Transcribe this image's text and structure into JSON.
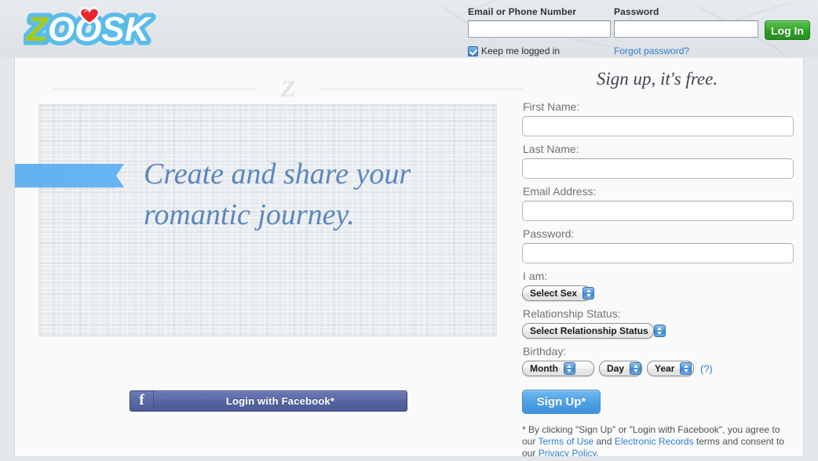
{
  "brand": {
    "name": "ZOOSK",
    "letters": [
      "Z",
      "O",
      "O",
      "S",
      "K"
    ],
    "colors": {
      "z_green": "#a9c90f",
      "letter_white": "#ffffff",
      "outline_blue": "#5bbcea",
      "heart_red": "#e8262b",
      "accent_blue": "#66b4f1",
      "link_blue": "#2f7fd4",
      "login_green": "#37ab2d",
      "facebook_blue": "#54649f",
      "signup_blue": "#4c9fe4"
    }
  },
  "login": {
    "email_label": "Email or Phone Number",
    "email_value": "",
    "email_placeholder": "",
    "password_label": "Password",
    "password_value": "",
    "password_placeholder": "",
    "keep_logged_in_label": "Keep me logged in",
    "keep_logged_in_checked": true,
    "forgot_password_label": "Forgot password?",
    "log_in_label": "Log In"
  },
  "hero": {
    "divider_mark": "Z",
    "tagline": "Create and share your romantic journey.",
    "facebook_button_label": "Login with Facebook*",
    "facebook_icon_glyph": "f"
  },
  "signup": {
    "title": "Sign up, it's free.",
    "fields": [
      {
        "label": "First Name:",
        "value": "",
        "placeholder": ""
      },
      {
        "label": "Last Name:",
        "value": "",
        "placeholder": ""
      },
      {
        "label": "Email Address:",
        "value": "",
        "placeholder": ""
      },
      {
        "label": "Password:",
        "value": "",
        "placeholder": ""
      }
    ],
    "sex": {
      "label": "I am:",
      "selected": "Select Sex"
    },
    "relationship": {
      "label": "Relationship Status:",
      "selected": "Select Relationship Status"
    },
    "birthday": {
      "label": "Birthday:",
      "month_selected": "Month",
      "day_selected": "Day",
      "year_selected": "Year",
      "help_label": "(?)"
    },
    "submit_label": "Sign Up*",
    "terms": {
      "part1": "* By clicking \"Sign Up\" or \"Login with Facebook\", you agree to our ",
      "link1": "Terms of Use",
      "part2": " and ",
      "link2": "Electronic Records",
      "part3": " terms and consent to our ",
      "link3": "Privacy Policy",
      "part4": "."
    }
  }
}
